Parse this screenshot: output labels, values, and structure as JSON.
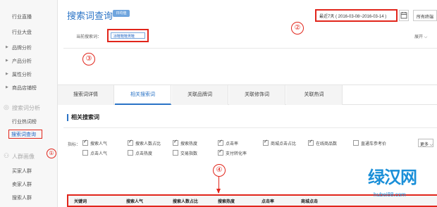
{
  "sidebar": {
    "items": [
      {
        "label": "行业直播"
      },
      {
        "label": "行业大盘"
      },
      {
        "label": "品牌分析"
      },
      {
        "label": "产品分析"
      },
      {
        "label": "属性分析"
      },
      {
        "label": "商品店铺榜"
      }
    ],
    "section_keyword": "搜索词分析",
    "kw_items": [
      {
        "label": "行业热词榜"
      },
      {
        "label": "搜索词查询"
      }
    ],
    "section_crowd": "人群画像",
    "crowd_items": [
      {
        "label": "买家人群"
      },
      {
        "label": "卖家人群"
      },
      {
        "label": "搜索人群"
      }
    ]
  },
  "header": {
    "title": "搜索词查询",
    "badge": "日均值",
    "date_range": "最近7天 ( 2016-03-08~2016-03-14 )",
    "all_terminals": "所有终端",
    "current_search_label": "当前搜索词：",
    "current_keyword": "凉鞋鞋鞋男鞋",
    "expand": "展开"
  },
  "tabs": [
    {
      "label": "搜索词详情",
      "active": false
    },
    {
      "label": "相关搜索词",
      "active": true
    },
    {
      "label": "关联品牌词",
      "active": false
    },
    {
      "label": "关联修饰词",
      "active": false
    },
    {
      "label": "关联热词",
      "active": false
    }
  ],
  "section": {
    "title": "相关搜索词"
  },
  "metrics": {
    "label": "指标：",
    "options": [
      {
        "label": "搜索人气",
        "checked": true
      },
      {
        "label": "搜索人数占比",
        "checked": true
      },
      {
        "label": "搜索热度",
        "checked": true
      },
      {
        "label": "点击率",
        "checked": true
      },
      {
        "label": "商城点击占比",
        "checked": true
      },
      {
        "label": "在线商品数",
        "checked": true
      },
      {
        "label": "直通车参考价",
        "checked": false
      },
      {
        "label": "点击人气",
        "checked": false
      },
      {
        "label": "点击热度",
        "checked": false
      },
      {
        "label": "交易指数",
        "checked": false
      },
      {
        "label": "支付转化率",
        "checked": true
      }
    ],
    "more": "更多"
  },
  "table": {
    "headers": [
      "关键词",
      "搜索人气",
      "搜索人数占比",
      "搜索热度",
      "点击率",
      "商城点击"
    ]
  },
  "annotations": [
    "①",
    "②",
    "③",
    "④"
  ],
  "watermark": {
    "main": "绿汉网",
    "url": "hubei88.com"
  },
  "colors": {
    "accent": "#2a73c6",
    "annotation": "#e1251b",
    "sidebar_bg": "#f7f7f7"
  }
}
